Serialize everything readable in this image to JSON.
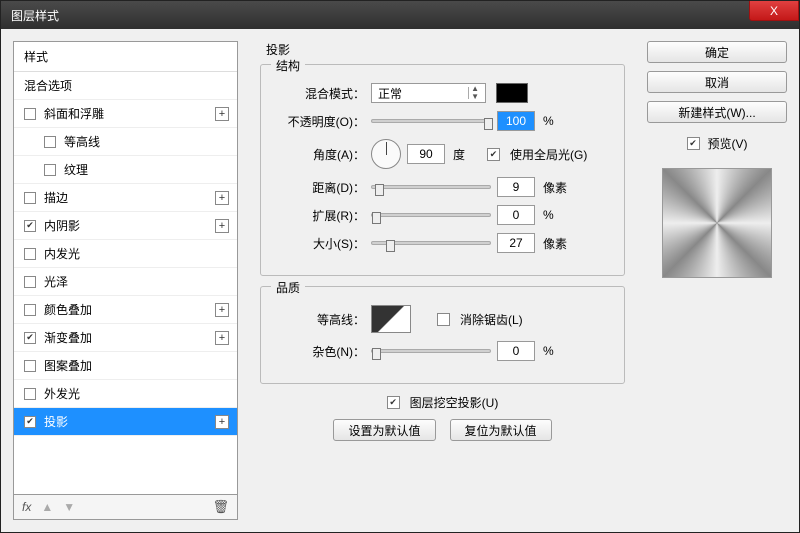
{
  "window": {
    "title": "图层样式"
  },
  "buttons": {
    "close": "X",
    "ok": "确定",
    "cancel": "取消",
    "newStyle": "新建样式(W)...",
    "preview": "预览(V)",
    "makeDefault": "设置为默认值",
    "resetDefault": "复位为默认值"
  },
  "styleList": {
    "header": "样式",
    "blendOptions": "混合选项",
    "items": [
      {
        "label": "斜面和浮雕",
        "checked": false,
        "plus": true,
        "sub": false
      },
      {
        "label": "等高线",
        "checked": false,
        "plus": false,
        "sub": true
      },
      {
        "label": "纹理",
        "checked": false,
        "plus": false,
        "sub": true
      },
      {
        "label": "描边",
        "checked": false,
        "plus": true,
        "sub": false
      },
      {
        "label": "内阴影",
        "checked": true,
        "plus": true,
        "sub": false
      },
      {
        "label": "内发光",
        "checked": false,
        "plus": false,
        "sub": false
      },
      {
        "label": "光泽",
        "checked": false,
        "plus": false,
        "sub": false
      },
      {
        "label": "颜色叠加",
        "checked": false,
        "plus": true,
        "sub": false
      },
      {
        "label": "渐变叠加",
        "checked": true,
        "plus": true,
        "sub": false
      },
      {
        "label": "图案叠加",
        "checked": false,
        "plus": false,
        "sub": false
      },
      {
        "label": "外发光",
        "checked": false,
        "plus": false,
        "sub": false
      },
      {
        "label": "投影",
        "checked": true,
        "plus": true,
        "sub": false,
        "selected": true
      }
    ],
    "footer": {
      "fx": "fx"
    }
  },
  "panel": {
    "main": "投影",
    "structure": "结构",
    "quality": "品质",
    "blendMode": {
      "label": "混合模式：",
      "value": "正常"
    },
    "opacity": {
      "label": "不透明度(O)：",
      "value": "100",
      "unit": "%"
    },
    "angle": {
      "label": "角度(A)：",
      "value": "90",
      "unit": "度",
      "globalLight": "使用全局光(G)",
      "globalOn": true
    },
    "distance": {
      "label": "距离(D)：",
      "value": "9",
      "unit": "像素"
    },
    "spread": {
      "label": "扩展(R)：",
      "value": "0",
      "unit": "%"
    },
    "size": {
      "label": "大小(S)：",
      "value": "27",
      "unit": "像素"
    },
    "contour": {
      "label": "等高线：",
      "antiAlias": "消除锯齿(L)",
      "antiOn": false
    },
    "noise": {
      "label": "杂色(N)：",
      "value": "0",
      "unit": "%"
    },
    "knockout": {
      "label": "图层挖空投影(U)",
      "on": true
    }
  }
}
